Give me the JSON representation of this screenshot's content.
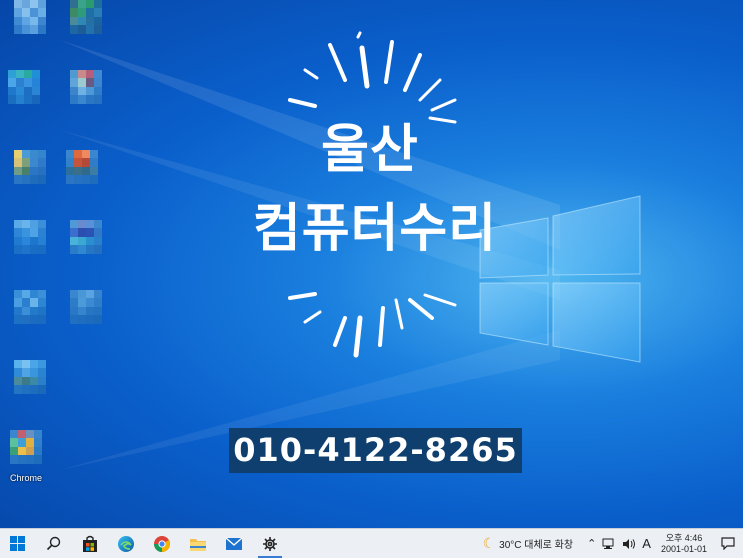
{
  "banner": {
    "line1": "울산",
    "line2": "컴퓨터수리",
    "phone": "010-4122-8265"
  },
  "desktop_icons": [
    {
      "name": "icon-1",
      "label": ""
    },
    {
      "name": "icon-2",
      "label": ""
    },
    {
      "name": "icon-3",
      "label": ""
    },
    {
      "name": "icon-4",
      "label": ""
    },
    {
      "name": "icon-5",
      "label": ""
    },
    {
      "name": "icon-6",
      "label": ""
    },
    {
      "name": "icon-7",
      "label": ""
    },
    {
      "name": "icon-8",
      "label": ""
    },
    {
      "name": "icon-9",
      "label": ""
    },
    {
      "name": "icon-10",
      "label": ""
    },
    {
      "name": "icon-11",
      "label": ""
    },
    {
      "name": "chrome",
      "label": "Chrome"
    }
  ],
  "taskbar": {
    "apps": [
      "start-icon",
      "search-icon",
      "store-icon",
      "edge-icon",
      "chrome-icon",
      "file-explorer-icon",
      "mail-icon",
      "settings-icon"
    ],
    "weather": "30°C  대체로 화창",
    "ime": "A",
    "clock": {
      "time": "오후 4:46",
      "date": "2001-01-01"
    }
  },
  "colors": {
    "accent": "#0a5fcb",
    "phone_bg": "#0e3f6e",
    "taskbar_bg": "#eceff4"
  }
}
